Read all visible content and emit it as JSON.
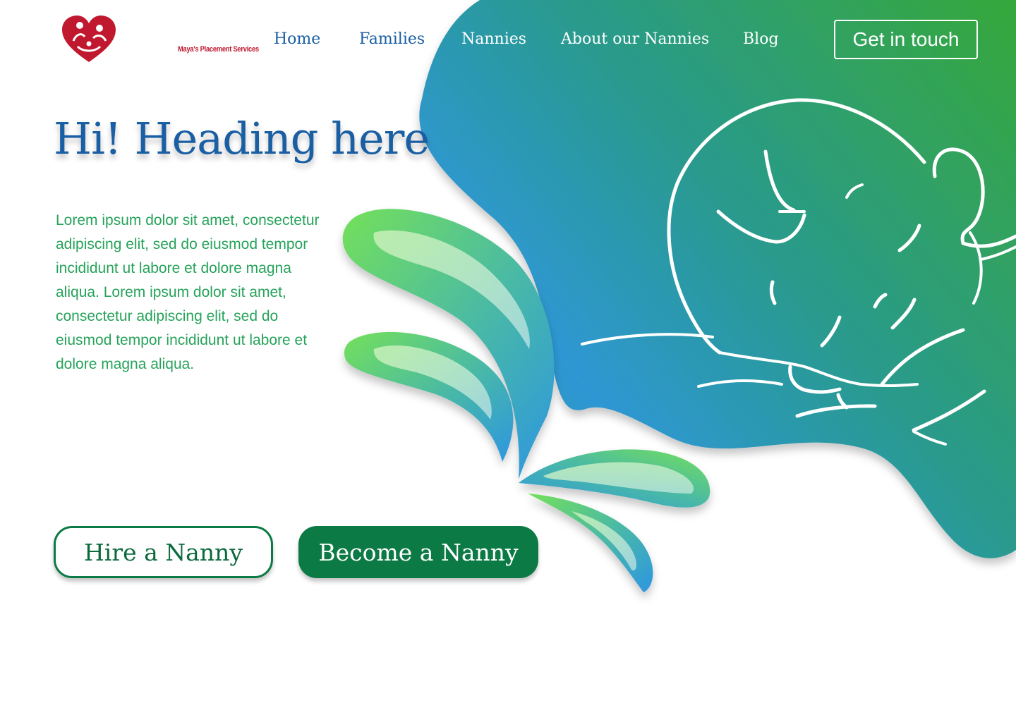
{
  "brand": {
    "name": "Maya's Placement Services",
    "color": "#c0182f"
  },
  "nav": {
    "items": [
      {
        "label": "Home"
      },
      {
        "label": "Families"
      },
      {
        "label": "Nannies"
      },
      {
        "label": "About our Nannies"
      },
      {
        "label": "Blog"
      }
    ],
    "cta_label": "Get in touch"
  },
  "hero": {
    "heading": "Hi! Heading here",
    "paragraph": "Lorem ipsum dolor sit amet, consectetur adipiscing elit, sed do eiusmod tempor incididunt ut labore et dolore magna aliqua. Lorem ipsum dolor sit amet, consectetur adipiscing elit, sed do eiusmod tempor incididunt ut labore et dolore magna aliqua.",
    "primary_button": "Hire a Nanny",
    "secondary_button": "Become a Nanny"
  },
  "illustration": {
    "subject": "sleeping-baby-line-art",
    "decor": "green-blue-splash-drops"
  },
  "colors": {
    "heading": "#1a5fa3",
    "body_text": "#26a35a",
    "button_green": "#0c7a45",
    "blob_green": "#36a83a",
    "blob_blue": "#2e97d4",
    "blob_teal": "#2a9a8c"
  }
}
